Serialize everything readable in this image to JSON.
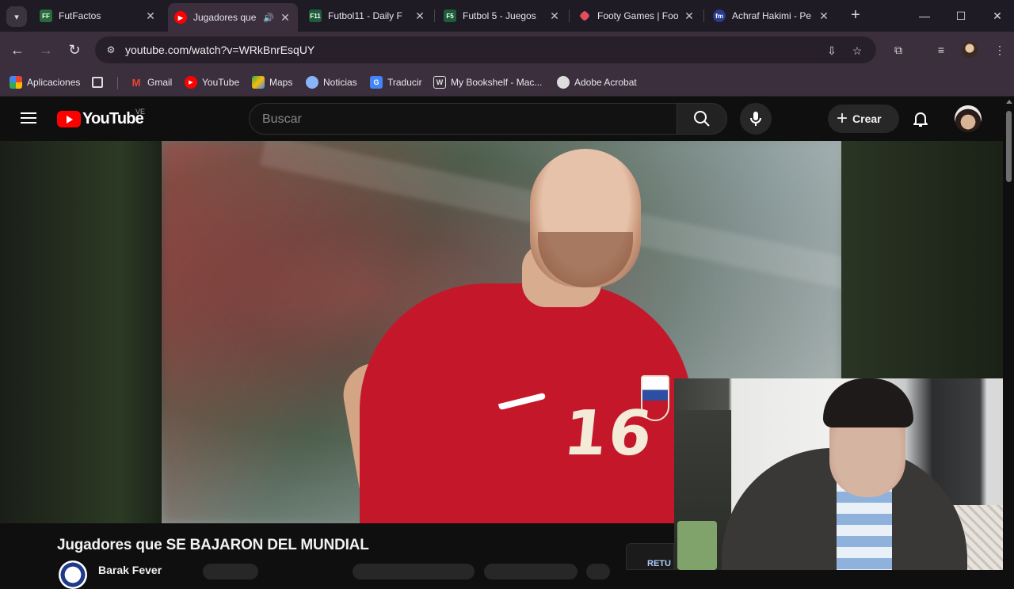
{
  "browser": {
    "tabs": [
      {
        "title": "FutFactos",
        "favicon": "FF",
        "color": "#2a6b3c",
        "active": false,
        "audio": false
      },
      {
        "title": "Jugadores que",
        "favicon": "yt",
        "color": "#ff0000",
        "active": true,
        "audio": true
      },
      {
        "title": "Futbol11 - Daily F",
        "favicon": "F11",
        "color": "#1e5d3b",
        "active": false,
        "audio": false
      },
      {
        "title": "Futbol 5 - Juegos",
        "favicon": "F5",
        "color": "#1e5d3b",
        "active": false,
        "audio": false
      },
      {
        "title": "Footy Games | Foo",
        "favicon": "fg",
        "color": "#e44d5b",
        "active": false,
        "audio": false
      },
      {
        "title": "Achraf Hakimi - Pe",
        "favicon": "fm",
        "color": "#2b3a8f",
        "active": false,
        "audio": false
      }
    ],
    "url": "youtube.com/watch?v=WRkBnrEsqUY",
    "bookmarks": [
      {
        "label": "Aplicaciones",
        "icon": "apps-grid-icon"
      },
      {
        "label": "",
        "icon": "grid-icon"
      },
      {
        "label": "Gmail",
        "icon": "gmail-icon"
      },
      {
        "label": "YouTube",
        "icon": "youtube-icon"
      },
      {
        "label": "Maps",
        "icon": "maps-icon"
      },
      {
        "label": "Noticias",
        "icon": "news-icon"
      },
      {
        "label": "Traducir",
        "icon": "translate-icon"
      },
      {
        "label": "My Bookshelf - Mac...",
        "icon": "bookshelf-icon"
      },
      {
        "label": "Adobe Acrobat",
        "icon": "acrobat-icon"
      }
    ]
  },
  "youtube": {
    "logo_text": "YouTube",
    "country_code": "VE",
    "search_placeholder": "Buscar",
    "create_label": "Crear",
    "video": {
      "jersey_number": "16",
      "title": "Jugadores que SE BAJARON DEL MUNDIAL",
      "channel": "Barak Fever",
      "ad_label": "RETU"
    }
  },
  "colors": {
    "accent": "#ff0000",
    "browser_frame": "#3b2f3e",
    "page_bg": "#0f0f0f"
  }
}
